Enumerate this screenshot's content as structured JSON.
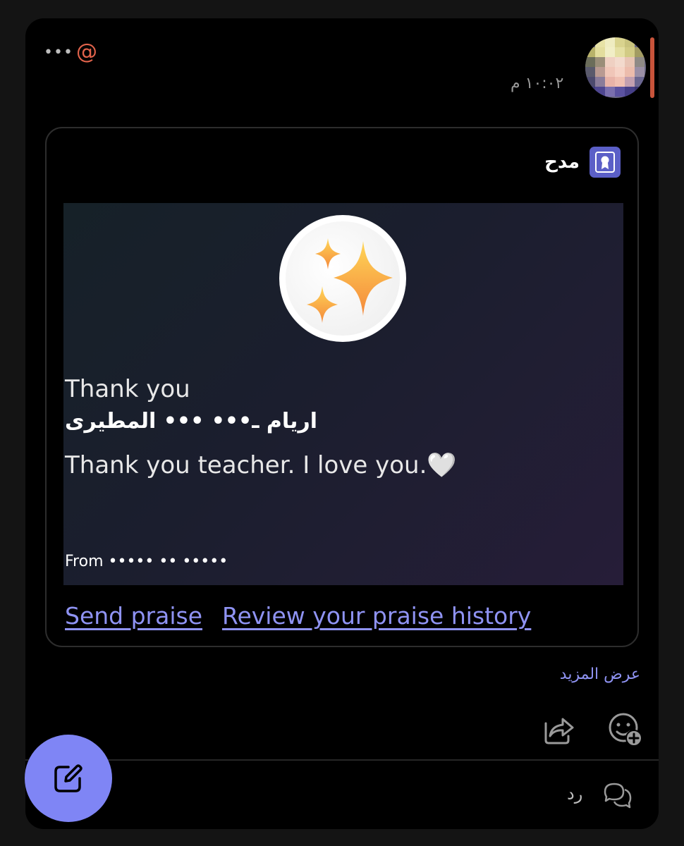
{
  "header": {
    "more_icon": "more-horizontal-icon",
    "mention_icon": "at-mention-icon",
    "timestamp": "١٠:٠٢ م"
  },
  "card": {
    "title": "مدح",
    "badge_icon": "award-icon",
    "image": {
      "badge_icon": "sparkle-icon",
      "thank_label": "Thank you",
      "recipient_name": "اريام ـ••• ••• المطيرى",
      "message": "Thank you teacher. I love you.🤍",
      "from_label": "From ••••• •• •••••"
    },
    "links": {
      "send_praise": "Send praise",
      "review_history": "Review your praise history"
    }
  },
  "see_more": "عرض المزيد",
  "actions": {
    "share_icon": "share-icon",
    "react_icon": "add-reaction-icon"
  },
  "reply": {
    "label": "رد",
    "icon": "chat-bubbles-icon"
  },
  "fab": {
    "icon": "compose-icon"
  },
  "colors": {
    "accent": "#7f85f5",
    "link": "#8f93f3",
    "mention": "#e2634b",
    "unread_indicator": "#c9543b",
    "background": "#000000"
  }
}
